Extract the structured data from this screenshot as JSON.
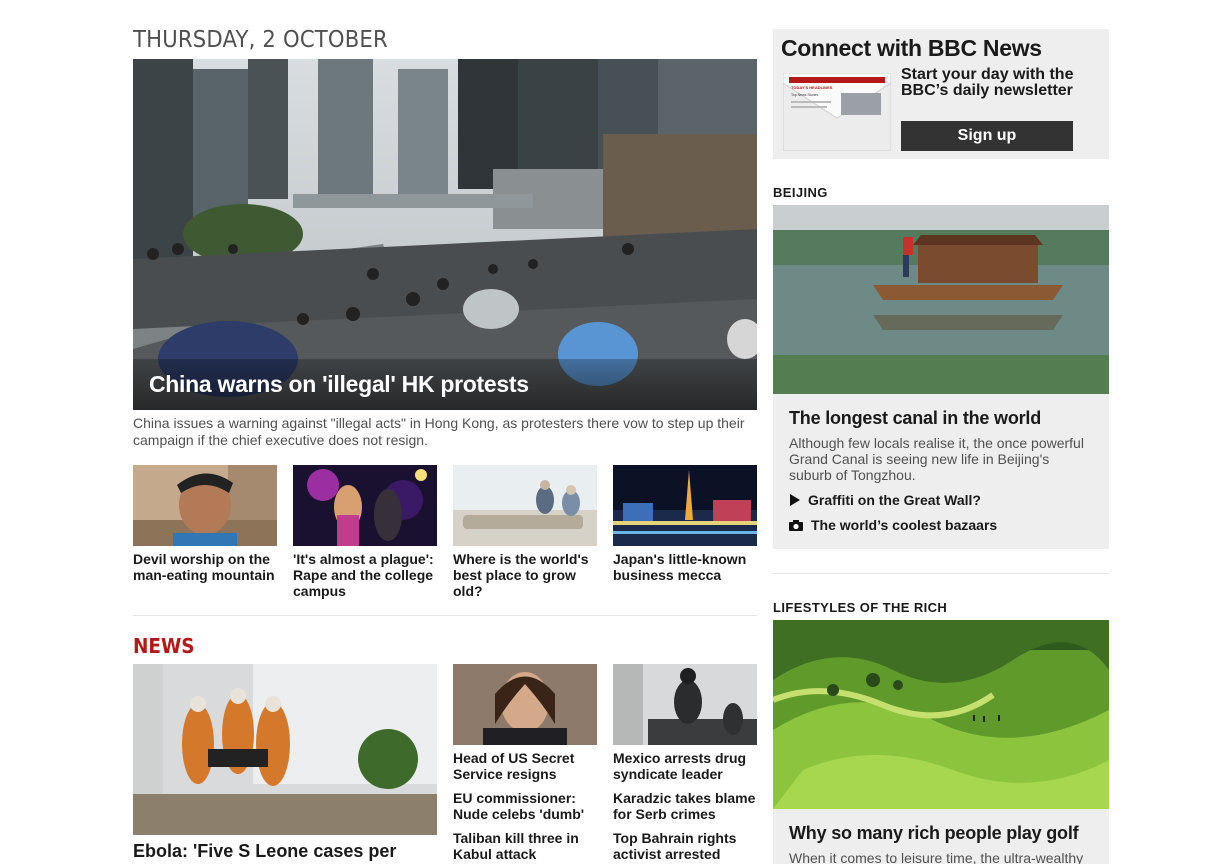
{
  "date_heading": "THURSDAY, 2 OCTOBER",
  "top_story": {
    "title": "China warns on 'illegal' HK protests",
    "summary": "China issues a warning against \"illegal acts\" in Hong Kong, as protesters there vow to step up their campaign if the chief executive does not resign."
  },
  "features": [
    {
      "title": "Devil worship on the man-eating mountain"
    },
    {
      "title": "'It's almost a plague': Rape and the college campus"
    },
    {
      "title": "Where is the world's best place to grow old?"
    },
    {
      "title": "Japan's little-known business mecca"
    }
  ],
  "news": {
    "heading": "NEWS",
    "main_title": "Ebola: 'Five S Leone cases per hour'",
    "col1": [
      "Head of US Secret Service resigns",
      "EU commissioner: Nude celebs 'dumb'",
      "Taliban kill three in Kabul attack"
    ],
    "col2": [
      "Mexico arrests drug syndicate leader",
      "Karadzic takes blame for Serb crimes",
      "Top Bahrain rights activist arrested"
    ]
  },
  "connect": {
    "title": "Connect with BBC News",
    "text": "Start your day with the BBC’s daily newsletter",
    "button": "Sign up",
    "newsletter_header": "TODAY'S HEADLINES",
    "newsletter_sub": "Top News Stories"
  },
  "beijing": {
    "heading": "BEIJING",
    "title": "The longest canal in the world",
    "summary": "Although few locals realise it, the once powerful Grand Canal is seeing new life in Beijing's suburb of Tongzhou.",
    "links": [
      {
        "icon": "play-icon",
        "label": "Graffiti on the Great Wall?"
      },
      {
        "icon": "camera-icon",
        "label": "The world’s coolest bazaars"
      }
    ]
  },
  "rich": {
    "heading": "LIFESTYLES OF THE RICH",
    "title": "Why so many rich people play golf",
    "summary": "When it comes to leisure time, the ultra-wealthy"
  },
  "colors": {
    "news_red": "#b31919",
    "panel_grey": "#eeeeee",
    "button_dark": "#333333"
  }
}
